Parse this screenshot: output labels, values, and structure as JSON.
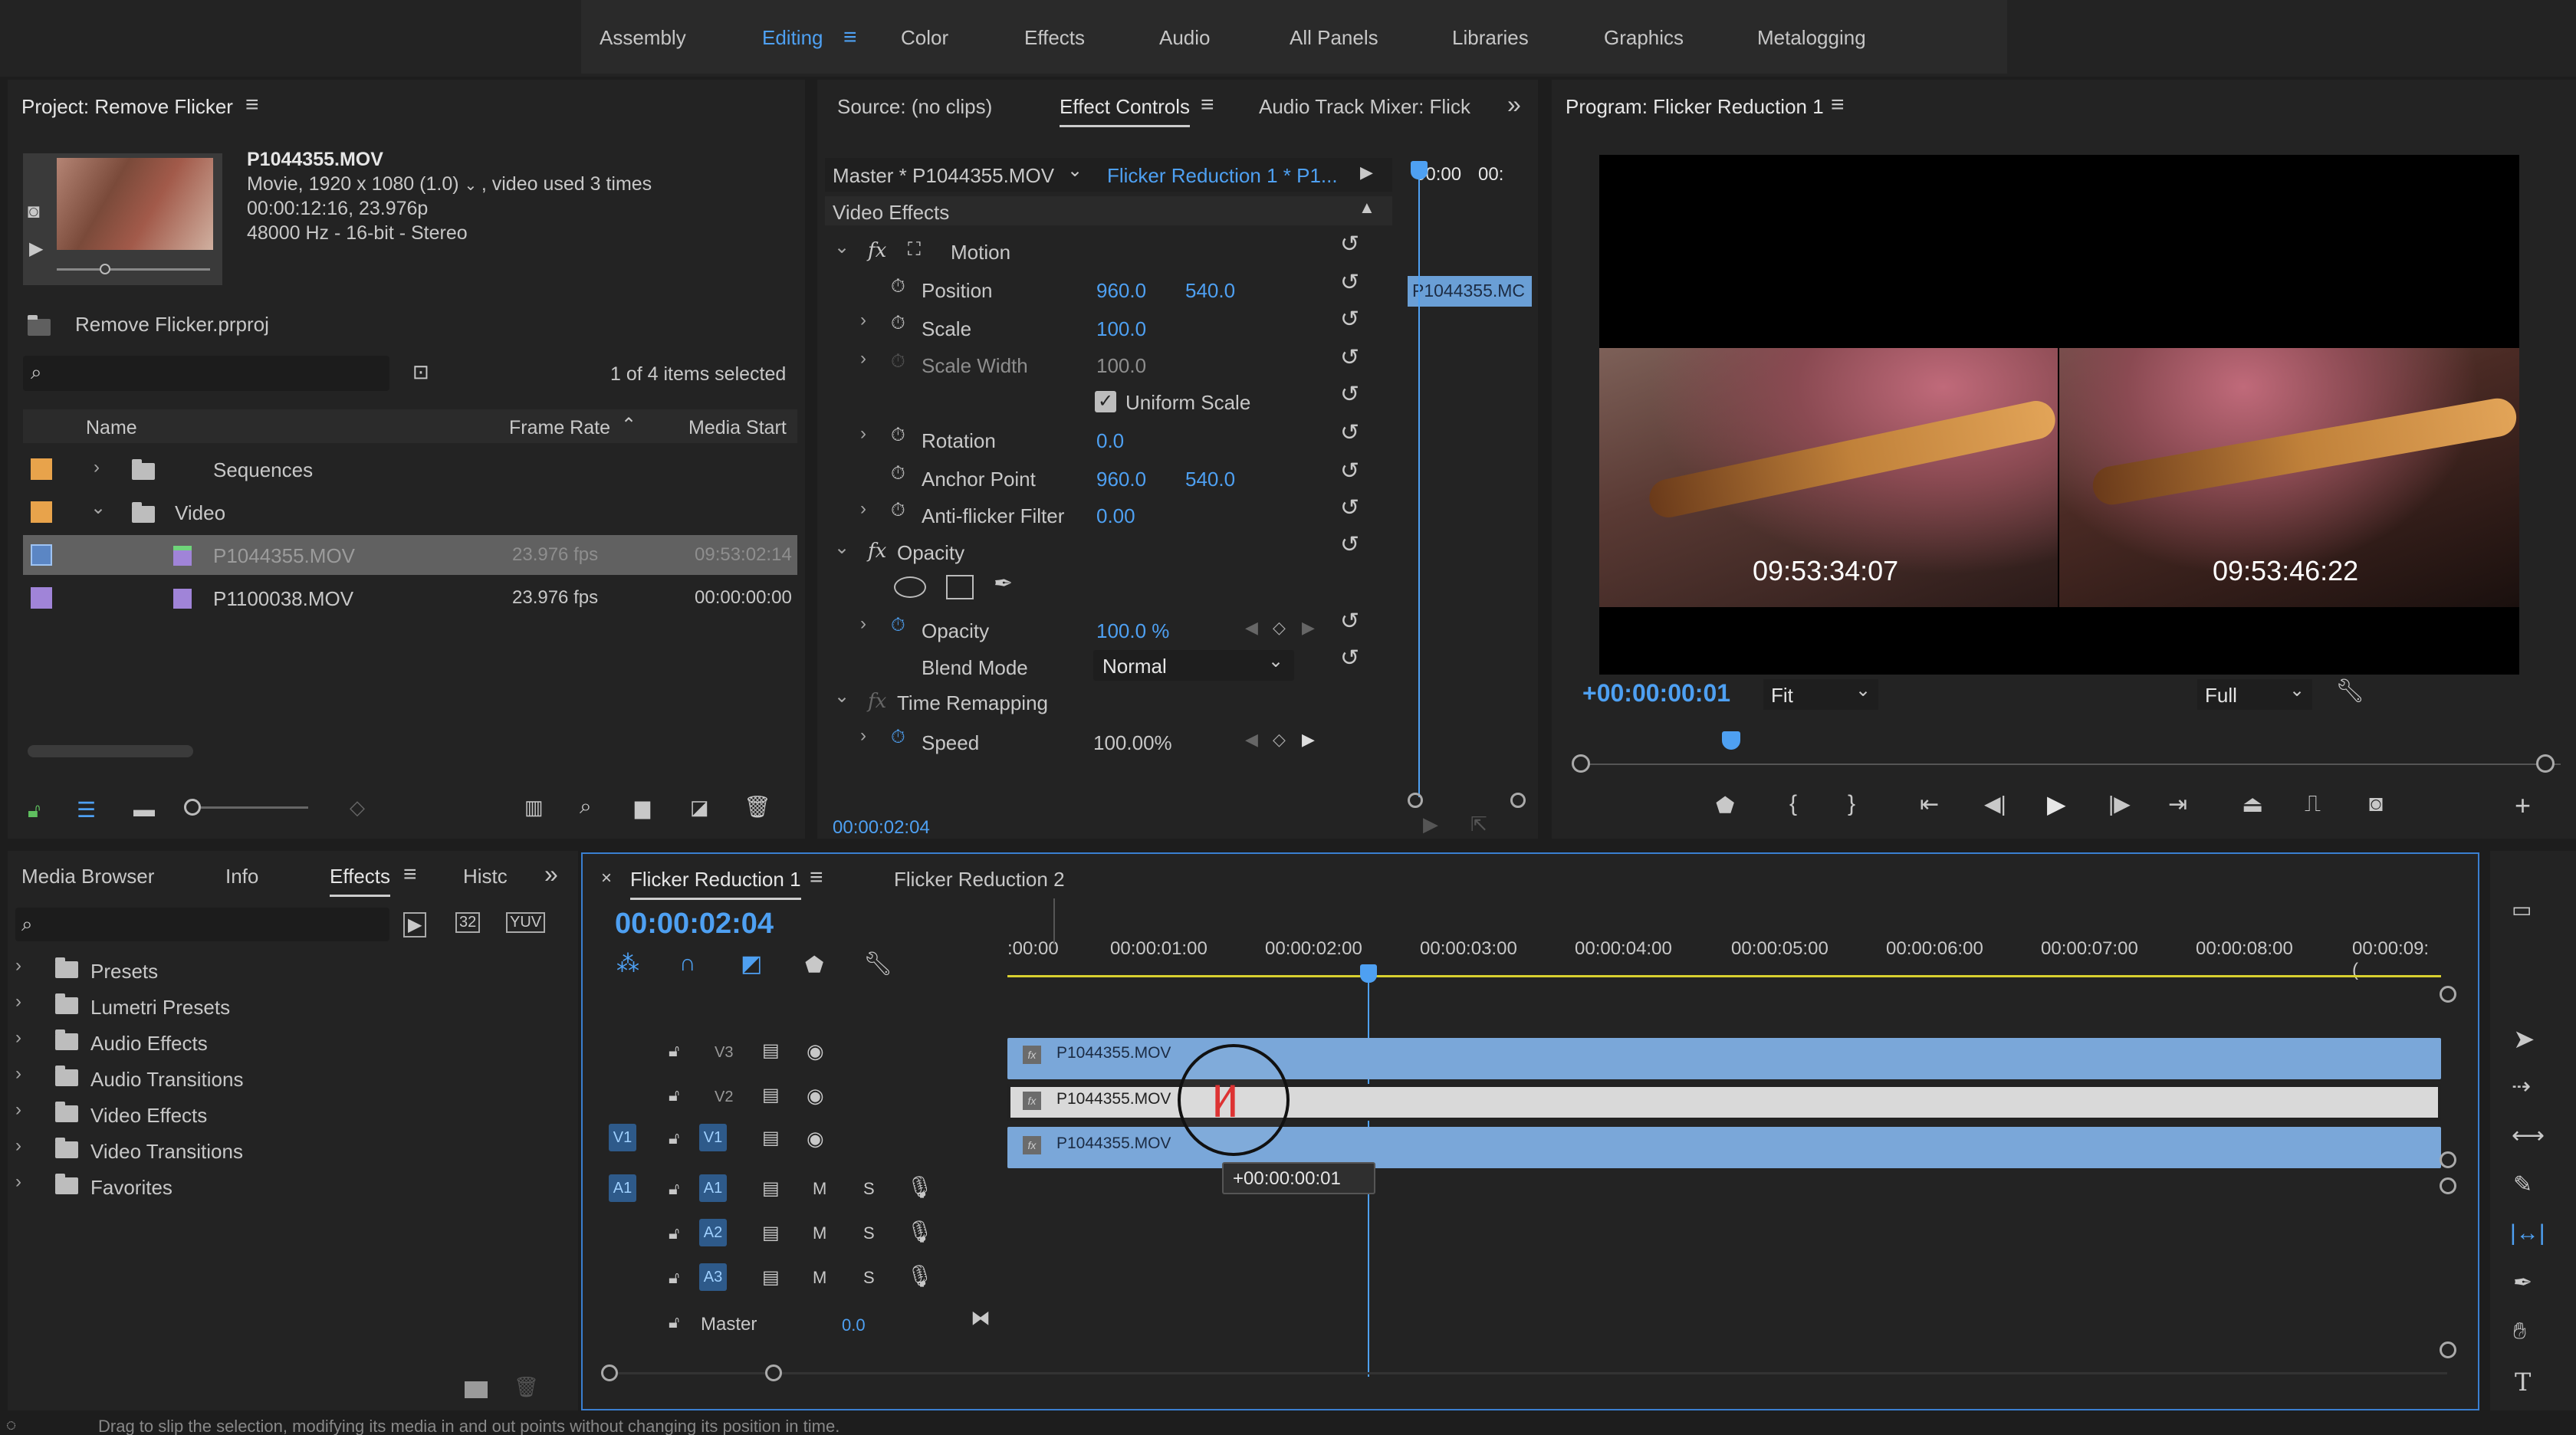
{
  "workspace_tabs": [
    "Assembly",
    "Editing",
    "Color",
    "Effects",
    "Audio",
    "All Panels",
    "Libraries",
    "Graphics",
    "Metalogging"
  ],
  "active_workspace": "Editing",
  "project": {
    "title": "Project: Remove Flicker",
    "clip_name": "P1044355.MOV",
    "clip_info_1": "Movie, 1920 x 1080 (1.0)",
    "clip_info_1b": ", video used 3 times",
    "clip_info_2": "00:00:12:16, 23.976p",
    "clip_info_3": "48000 Hz - 16-bit - Stereo",
    "project_file": "Remove Flicker.prproj",
    "items_selected": "1 of 4 items selected",
    "col_name": "Name",
    "col_frame_rate": "Frame Rate",
    "col_media_start": "Media Start",
    "rows": [
      {
        "name": "Sequences",
        "fps": "",
        "start": "",
        "color": "#e8a34b"
      },
      {
        "name": "Video",
        "fps": "",
        "start": "",
        "color": "#e8a34b"
      },
      {
        "name": "P1044355.MOV",
        "fps": "23.976 fps",
        "start": "09:53:02:14",
        "color": "#5b86c4"
      },
      {
        "name": "P1100038.MOV",
        "fps": "23.976 fps",
        "start": "00:00:00:00",
        "color": "#a084d8"
      }
    ]
  },
  "source_tabs": {
    "source": "Source: (no clips)",
    "effect_controls": "Effect Controls",
    "audio_mixer": "Audio Track Mixer: Flick"
  },
  "effect_controls": {
    "master": "Master * P1044355.MOV",
    "sequence": "Flicker Reduction 1 * P1...",
    "mini_time_1": "00:00",
    "mini_time_2": "00:",
    "mini_clip": "P1044355.MC",
    "section": "Video Effects",
    "motion": "Motion",
    "position_label": "Position",
    "position_x": "960.0",
    "position_y": "540.0",
    "scale_label": "Scale",
    "scale_val": "100.0",
    "scale_width_label": "Scale Width",
    "scale_width_val": "100.0",
    "uniform_scale": "Uniform Scale",
    "rotation_label": "Rotation",
    "rotation_val": "0.0",
    "anchor_label": "Anchor Point",
    "anchor_x": "960.0",
    "anchor_y": "540.0",
    "antiflicker_label": "Anti-flicker Filter",
    "antiflicker_val": "0.00",
    "opacity_section": "Opacity",
    "opacity_label": "Opacity",
    "opacity_val": "100.0 %",
    "blend_label": "Blend Mode",
    "blend_val": "Normal",
    "time_remap": "Time Remapping",
    "speed_label": "Speed",
    "speed_val": "100.00%",
    "timecode": "00:00:02:04"
  },
  "program": {
    "title": "Program: Flicker Reduction 1",
    "tc_left": "09:53:34:07",
    "tc_right": "09:53:46:22",
    "offset": "+00:00:00:01",
    "fit": "Fit",
    "full": "Full"
  },
  "lower_left_tabs": [
    "Media Browser",
    "Info",
    "Effects",
    "Histc"
  ],
  "effects_tree": [
    "Presets",
    "Lumetri Presets",
    "Audio Effects",
    "Audio Transitions",
    "Video Effects",
    "Video Transitions",
    "Favorites"
  ],
  "timeline": {
    "tab1": "Flicker Reduction 1",
    "tab2": "Flicker Reduction 2",
    "timecode": "00:00:02:04",
    "ruler": [
      ":00:00",
      "00:00:01:00",
      "00:00:02:00",
      "00:00:03:00",
      "00:00:04:00",
      "00:00:05:00",
      "00:00:06:00",
      "00:00:07:00",
      "00:00:08:00",
      "00:00:09:("
    ],
    "tracks": [
      "V3",
      "V2",
      "V1",
      "A1",
      "A2",
      "A3"
    ],
    "src_v1": "V1",
    "src_a1": "A1",
    "clip_v3": "P1044355.MOV",
    "clip_v2": "P1044355.MOV",
    "clip_v1": "P1044355.MOV",
    "tooltip": "+00:00:00:01",
    "master": "Master",
    "master_val": "0.0",
    "m": "M",
    "s": "S"
  },
  "icons": {
    "search": "search-icon",
    "wrench": "wrench-icon",
    "play": "play-icon"
  },
  "status": "Drag to slip the selection, modifying its media in and out points without changing its position in time.",
  "colors": {
    "accent": "#4ea0f2",
    "clip": "#7aa7d9",
    "playhead": "#4ea0f2"
  }
}
